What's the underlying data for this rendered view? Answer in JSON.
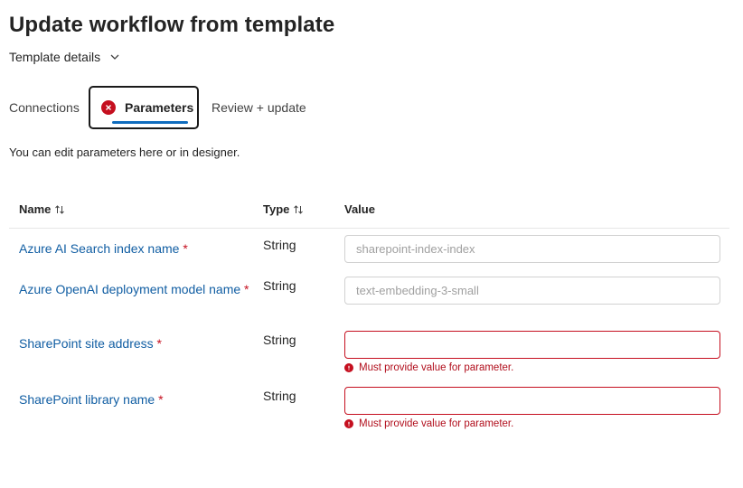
{
  "page": {
    "title": "Update workflow from template",
    "template_details_label": "Template details"
  },
  "tabs": [
    {
      "label": "Connections",
      "selected": false,
      "error": false
    },
    {
      "label": "Parameters",
      "selected": true,
      "error": true
    },
    {
      "label": "Review + update",
      "selected": false,
      "error": false
    }
  ],
  "intro_text": "You can edit parameters here or in designer.",
  "table": {
    "headers": {
      "name": "Name",
      "type": "Type",
      "value": "Value"
    },
    "rows": [
      {
        "name": "Azure AI Search index name",
        "required": "*",
        "type": "String",
        "value": "",
        "placeholder": "sharepoint-index-index",
        "error": ""
      },
      {
        "name": "Azure OpenAI deployment model name",
        "required": "*",
        "type": "String",
        "value": "",
        "placeholder": "text-embedding-3-small",
        "error": ""
      },
      {
        "name": "SharePoint site address",
        "required": "*",
        "type": "String",
        "value": "",
        "placeholder": "",
        "error": "Must provide value for parameter."
      },
      {
        "name": "SharePoint library name",
        "required": "*",
        "type": "String",
        "value": "",
        "placeholder": "",
        "error": "Must provide value for parameter."
      }
    ]
  },
  "colors": {
    "accent": "#0f6cbd",
    "link": "#115ea3",
    "error": "#c50f1f"
  }
}
